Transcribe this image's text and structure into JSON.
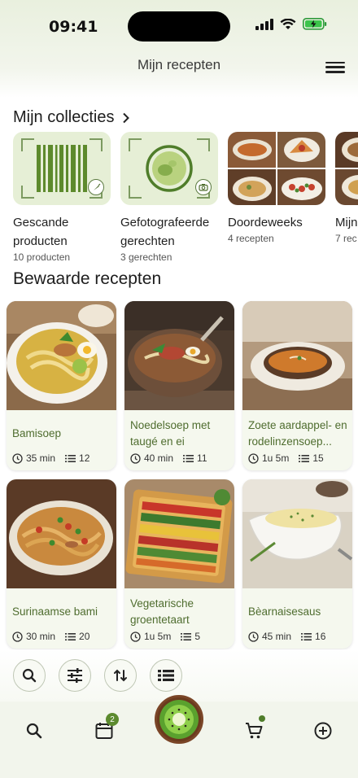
{
  "status": {
    "time": "09:41"
  },
  "header": {
    "title": "Mijn recepten"
  },
  "collections": {
    "title": "Mijn collecties",
    "items": [
      {
        "name": "Gescande producten",
        "count": "10 producten",
        "icon": "barcode-icon"
      },
      {
        "name": "Gefotografeerde gerechten",
        "count": "3 gerechten",
        "icon": "camera-lens-icon"
      },
      {
        "name": "Doordeweeks",
        "count": "4 recepten",
        "icon": "photo-collage"
      },
      {
        "name": "Mijn kook",
        "count": "7 rec",
        "icon": "photo"
      }
    ]
  },
  "saved": {
    "title": "Bewaarde recepten",
    "recipes": [
      {
        "title": "Bamisoep",
        "time": "35 min",
        "items": "12"
      },
      {
        "title": "Noedelsoep met taugé en ei",
        "time": "40 min",
        "items": "11"
      },
      {
        "title": "Zoete aardappel- en rodelinzensoep...",
        "time": "1u 5m",
        "items": "15"
      },
      {
        "title": "Surinaamse bami",
        "time": "30 min",
        "items": "20"
      },
      {
        "title": "Vegetarische groentetaart",
        "time": "1u 5m",
        "items": "5"
      },
      {
        "title": "Bèarnaisesaus",
        "time": "45 min",
        "items": "16"
      }
    ]
  },
  "toolbar": {
    "buttons": [
      "search-icon",
      "filter-sliders-icon",
      "sort-icon",
      "list-view-icon"
    ]
  },
  "tabbar": {
    "calendar_badge": "2"
  },
  "colors": {
    "accent": "#4f6d2f",
    "background": "#f2f5ec",
    "thumb": "#e6efd6"
  }
}
